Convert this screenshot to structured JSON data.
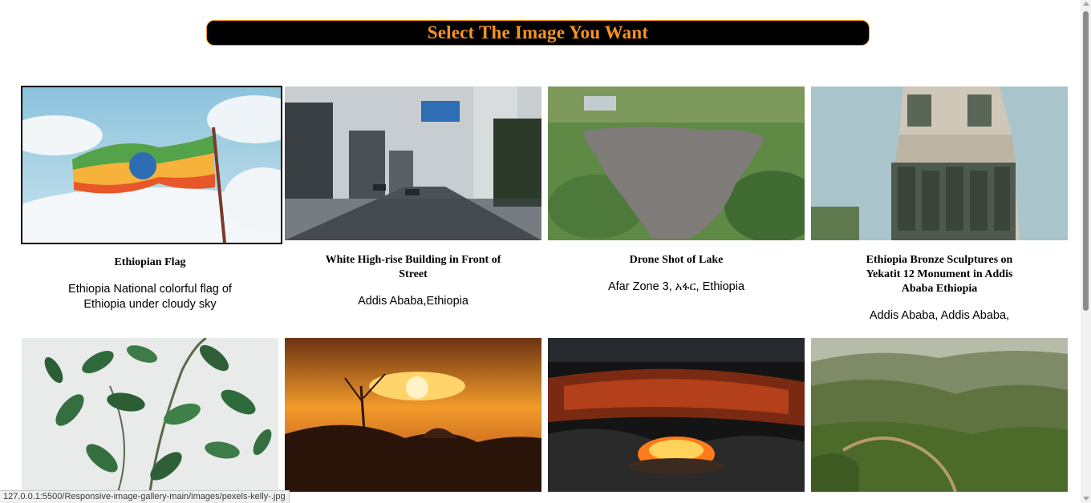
{
  "header": {
    "title": "Select The Image You Want"
  },
  "gallery": {
    "items": [
      {
        "title": "Ethiopian Flag",
        "description": "Ethiopia National colorful flag of Ethiopia under cloudy sky",
        "image": "ethiopian-flag-photo",
        "selected": true
      },
      {
        "title": "White High-rise Building in Front of Street",
        "description": "Addis Ababa,Ethiopia",
        "image": "rainy-street-photo",
        "selected": false
      },
      {
        "title": "Drone Shot of Lake",
        "description": "Afar Zone 3, አፋር, Ethiopia",
        "image": "lake-drone-photo",
        "selected": false
      },
      {
        "title": "Ethiopia Bronze Sculptures on Yekatit 12 Monument in Addis Ababa Ethiopia",
        "description": "Addis Ababa, Addis Ababa,",
        "image": "monument-photo",
        "selected": false
      },
      {
        "title": "",
        "description": "",
        "image": "green-leaves-photo",
        "selected": false
      },
      {
        "title": "",
        "description": "",
        "image": "sunset-photo",
        "selected": false
      },
      {
        "title": "",
        "description": "",
        "image": "lava-lake-photo",
        "selected": false
      },
      {
        "title": "",
        "description": "",
        "image": "mountain-road-photo",
        "selected": false
      }
    ]
  },
  "status_bar": {
    "url": "127.0.0.1:5500/Responsive-image-gallery-main/images/pexels-kelly-.jpg"
  }
}
